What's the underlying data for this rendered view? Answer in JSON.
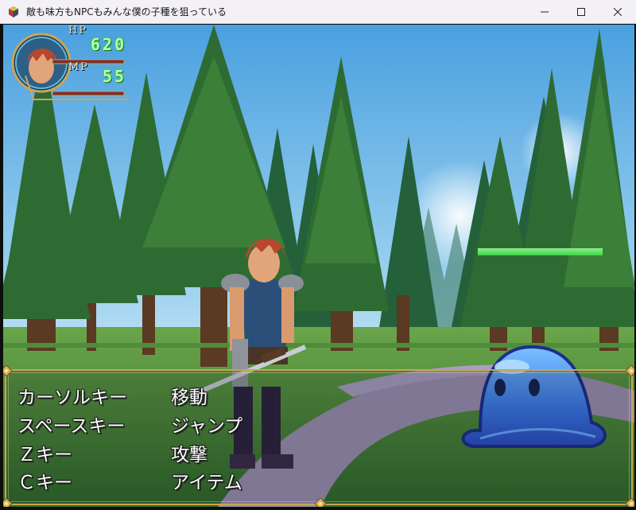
{
  "window": {
    "title": "敵も味方もNPCもみんな僕の子種を狙っている",
    "app_icon": "rpg-game-icon"
  },
  "hud": {
    "hp_label": "HP",
    "hp_value": "620",
    "mp_label": "MP",
    "mp_value": "55",
    "hp_gauge": 1.0,
    "mp_gauge": 1.0
  },
  "enemy": {
    "name_visible": false,
    "hp_fraction": 1.0
  },
  "help": {
    "rows": [
      {
        "key": "カーソルキー",
        "action": "移動"
      },
      {
        "key": "スペースキー",
        "action": "ジャンプ"
      },
      {
        "key": "Ｚキー",
        "action": "攻撃"
      },
      {
        "key": "Ｃキー",
        "action": "アイテム"
      }
    ]
  },
  "colors": {
    "frame_gold": "#c8a54f",
    "hp_text_green": "#baff9a",
    "enemy_hp_green": "#3fd24a",
    "slime_blue": "#3a7be8"
  }
}
